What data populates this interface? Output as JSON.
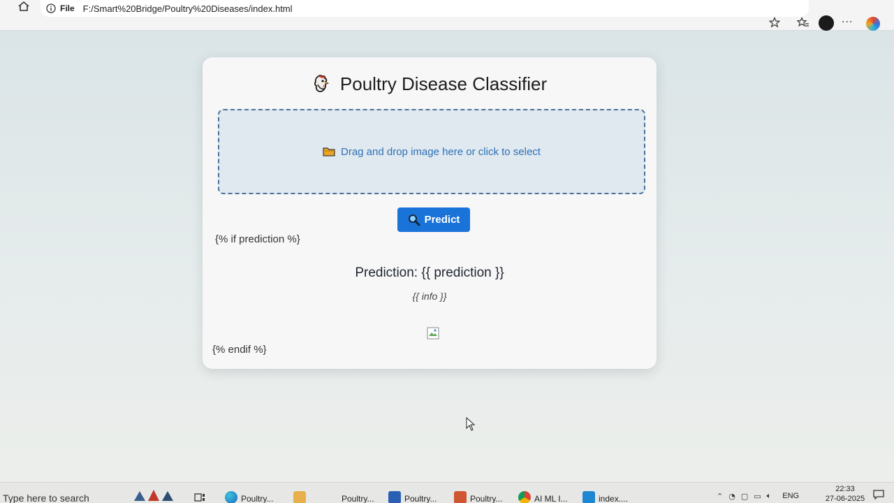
{
  "browser": {
    "file_label": "File",
    "url": "F:/Smart%20Bridge/Poultry%20Diseases/index.html",
    "more_label": "···"
  },
  "page": {
    "title": "Poultry Disease Classifier",
    "title_icon": "rooster-icon",
    "drop_zone_text": "Drag and drop image here or click to select",
    "drop_zone_icon": "folder-icon",
    "predict_label": "Predict",
    "predict_icon": "magnifier-icon",
    "template_if": "{% if prediction %}",
    "prediction_text": "Prediction: {{ prediction }}",
    "info_text": "{{ info }}",
    "template_endif": "{% endif %}"
  },
  "colors": {
    "accent": "#1a73d9",
    "drop_border": "#4d6f9a",
    "drop_text": "#2f6fb7"
  },
  "taskbar": {
    "search_placeholder": "Type here to search",
    "items": [
      {
        "label": "Poultry...",
        "icon": "edge-icon"
      },
      {
        "label": "Poultry...",
        "icon": "folder-icon"
      },
      {
        "label": "Poultry...",
        "icon": "word-icon"
      },
      {
        "label": "Poultry...",
        "icon": "powerpoint-icon"
      },
      {
        "label": "AI ML I...",
        "icon": "chrome-icon"
      },
      {
        "label": "index....",
        "icon": "vscode-icon"
      }
    ],
    "language": "ENG",
    "time": "22:33",
    "date": "27-06-2025"
  }
}
